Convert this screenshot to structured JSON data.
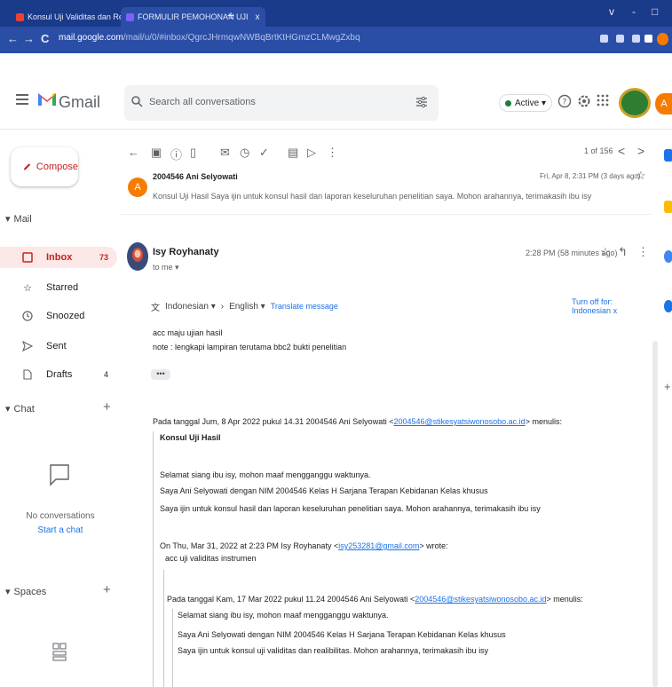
{
  "browser": {
    "tabs": [
      {
        "title": "Konsul Uji Validitas dan Reliabili",
        "close": "x",
        "favicon_color": "#ea4335"
      },
      {
        "title": "FORMULIR PEMOHONAN UJI",
        "close": "x",
        "favicon_color": "#7b61ff"
      }
    ],
    "new_tab": "+",
    "window_controls": [
      "v",
      "-",
      "□"
    ],
    "nav": {
      "back": "←",
      "forward": "→",
      "reload": "C"
    },
    "url_host": "mail.google.com",
    "url_path": "/mail/u/0/#inbox/QgrcJHrmqwNWBqBrtKtHGmzCLMwgZxbq"
  },
  "gmail": {
    "logo_text": "Gmail",
    "search_placeholder": "Search all conversations",
    "active_label": "Active ▾",
    "avatar_letter": "A"
  },
  "sidebar": {
    "compose": "Compose",
    "mail_header": "Mail",
    "items": [
      {
        "label": "Inbox",
        "count": "73",
        "icon": "inbox-icon"
      },
      {
        "label": "Starred",
        "count": "",
        "icon": "star-icon"
      },
      {
        "label": "Snoozed",
        "count": "",
        "icon": "clock-icon"
      },
      {
        "label": "Sent",
        "count": "",
        "icon": "send-icon"
      },
      {
        "label": "Drafts",
        "count": "4",
        "icon": "draft-icon"
      }
    ],
    "chat_header": "Chat",
    "no_conversations": "No conversations",
    "start_chat": "Start a chat",
    "spaces_header": "Spaces"
  },
  "toolbar": {
    "pager": "1 of 156",
    "prev": "<",
    "next": ">"
  },
  "previous_message": {
    "avatar_letter": "A",
    "from": "2004546 Ani Selyowati",
    "date": "Fri, Apr 8, 2:31 PM (3 days ago)",
    "snippet": "Konsul Uji Hasil Saya ijin untuk konsul hasil dan laporan keseluruhan penelitian saya. Mohon arahannya, terimakasih ibu isy"
  },
  "message": {
    "sender": "Isy Royhanaty",
    "to": "to me ▾",
    "time": "2:28 PM (58 minutes ago)",
    "translate_from": "Indonesian ▾",
    "translate_arrow": "›",
    "translate_to": "English ▾",
    "translate_link": "Translate message",
    "turn_off": "Turn off for: Indonesian",
    "turn_off_x": "x",
    "body": [
      "acc maju ujian hasil",
      "note : lengkapi lampiran terutama bbc2 bukti penelitian"
    ],
    "ellipsis": "•••"
  },
  "quoted": {
    "intro_prefix": "Pada tanggal Jum, 8 Apr 2022 pukul 14.31 2004546 Ani Selyowati <",
    "intro_email": "2004546@stikesyatsiwonosobo.ac.id",
    "intro_suffix": "> menulis:",
    "subject": "Konsul Uji Hasil",
    "lines": [
      "Selamat siang ibu isy, mohon maaf mengganggu waktunya.",
      "Saya Ani Selyowati dengan NIM 2004546 Kelas H Sarjana Terapan Kebidanan Kelas khusus",
      "Saya ijin untuk konsul hasil dan laporan keseluruhan penelitian saya. Mohon arahannya, terimakasih ibu isy"
    ],
    "on_prefix": "On Thu, Mar 31, 2022 at 2:23 PM Isy Royhanaty <",
    "on_email": "isy253281@gmail.com",
    "on_suffix": "> wrote:",
    "acc_line": "acc uji validitas instrumen",
    "nested_prefix": "Pada tanggal Kam, 17 Mar 2022 pukul 11.24 2004546 Ani Selyowati <",
    "nested_email": "2004546@stikesyatsiwonosobo.ac.id",
    "nested_suffix": "> menulis:",
    "nested_lines": [
      "Selamat siang ibu isy, mohon maaf mengganggu waktunya.",
      "Saya Ani Selyowati dengan NIM 2004546 Kelas H Sarjana Terapan Kebidanan Kelas khusus",
      "Saya ijin untuk konsul uji validitas dan realibilitas. Mohon arahannya, terimakasih ibu isy"
    ]
  },
  "colors": {
    "tabbar": "#1a3a8a",
    "addressbar": "#2a4ea6",
    "inbox_selected_bg": "#fce8e6",
    "accent_red": "#c5221f",
    "link": "#1a73e8",
    "avatar_orange": "#f57c00"
  }
}
